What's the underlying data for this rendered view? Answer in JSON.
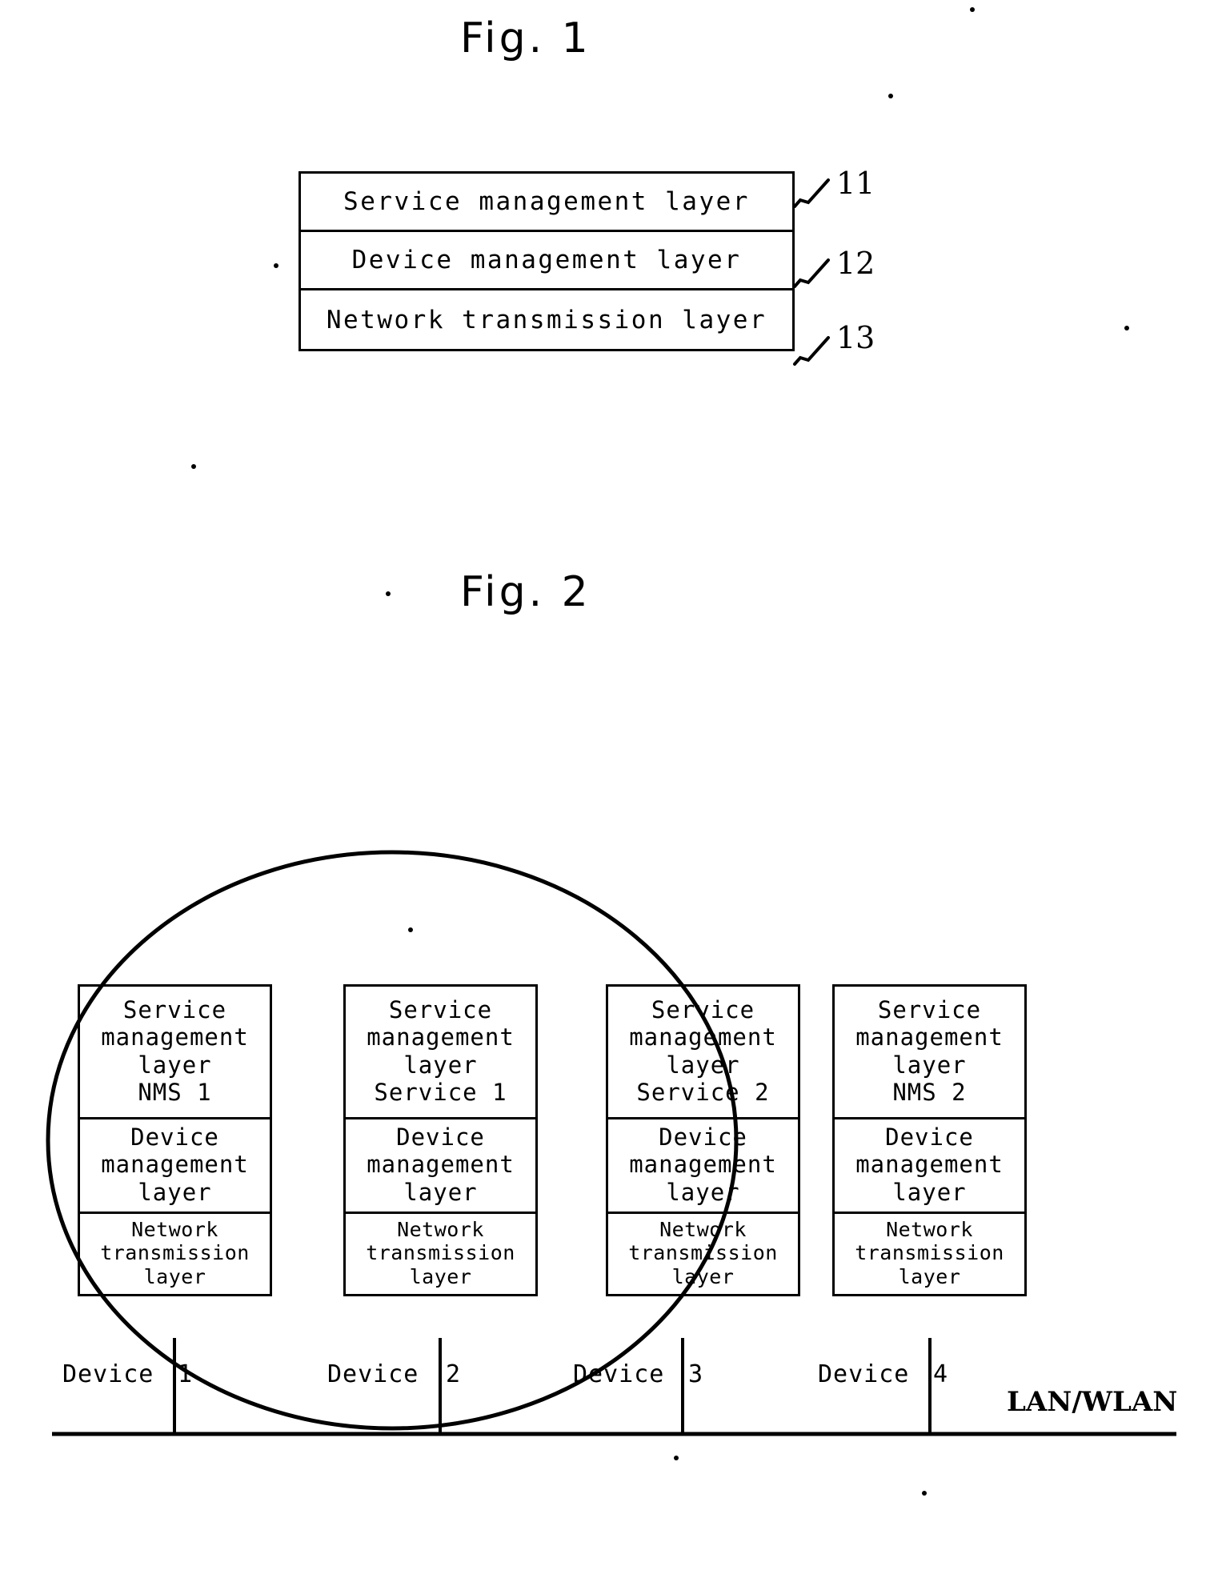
{
  "figures": [
    {
      "id": "fig1",
      "title": "Fig. 1",
      "layers": [
        {
          "label": "Service management layer",
          "ref": "11"
        },
        {
          "label": "Device management layer",
          "ref": "12"
        },
        {
          "label": "Network transmission layer",
          "ref": "13"
        }
      ]
    },
    {
      "id": "fig2",
      "title": "Fig. 2",
      "network_label": "LAN/WLAN",
      "devices": [
        {
          "label": "Device",
          "number": "1",
          "service_layer": "Service\nmanagement\nlayer\nNMS 1",
          "device_layer": "Device\nmanagement\nlayer",
          "network_layer": "Network\ntransmission\nlayer"
        },
        {
          "label": "Device",
          "number": "2",
          "service_layer": "Service\nmanagement\nlayer\nService 1",
          "device_layer": "Device\nmanagement\nlayer",
          "network_layer": "Network\ntransmission\nlayer"
        },
        {
          "label": "Device",
          "number": "3",
          "service_layer": "Service\nmanagement\nlayer\nService 2",
          "device_layer": "Device\nmanagement\nlayer",
          "network_layer": "Network\ntransmission\nlayer"
        },
        {
          "label": "Device",
          "number": "4",
          "service_layer": "Service\nmanagement\nlayer\nNMS 2",
          "device_layer": "Device\nmanagement\nlayer",
          "network_layer": "Network\ntransmission\nlayer"
        }
      ]
    }
  ],
  "colors": {
    "ink": "#000000",
    "paper": "#ffffff"
  }
}
